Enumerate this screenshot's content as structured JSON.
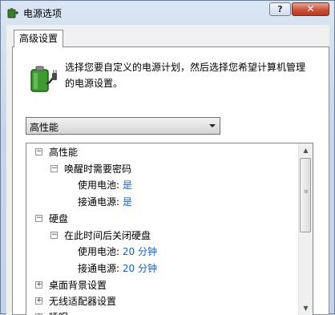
{
  "window": {
    "title": "电源选项",
    "help_label": "?",
    "close_label": "✕"
  },
  "tabs": [
    {
      "label": "高级设置"
    }
  ],
  "description": "选择您要自定义的电源计划，然后选择您希望计算机管理的电源设置。",
  "plan_select": {
    "value": "高性能"
  },
  "tree": {
    "root": "高性能",
    "wake_password": "唤醒时需要密码",
    "wake_battery_label": "使用电池:",
    "wake_battery_value": "是",
    "wake_plugged_label": "接通电源:",
    "wake_plugged_value": "是",
    "hdd": "硬盘",
    "hdd_off": "在此时间后关闭硬盘",
    "hdd_battery_label": "使用电池:",
    "hdd_battery_value": "20 分钟",
    "hdd_plugged_label": "接通电源:",
    "hdd_plugged_value": "20 分钟",
    "desktop_bg": "桌面背景设置",
    "wireless": "无线适配器设置",
    "sleep": "睡眠"
  },
  "expand_glyphs": {
    "collapsed": "+",
    "expanded": "−"
  },
  "colors": {
    "value_text": "#1a5fb4",
    "close_button": "#c8543b",
    "title_bar": "#dbe6f4"
  },
  "icons": {
    "app": "power-options-icon",
    "panel": "battery-plug-icon"
  }
}
